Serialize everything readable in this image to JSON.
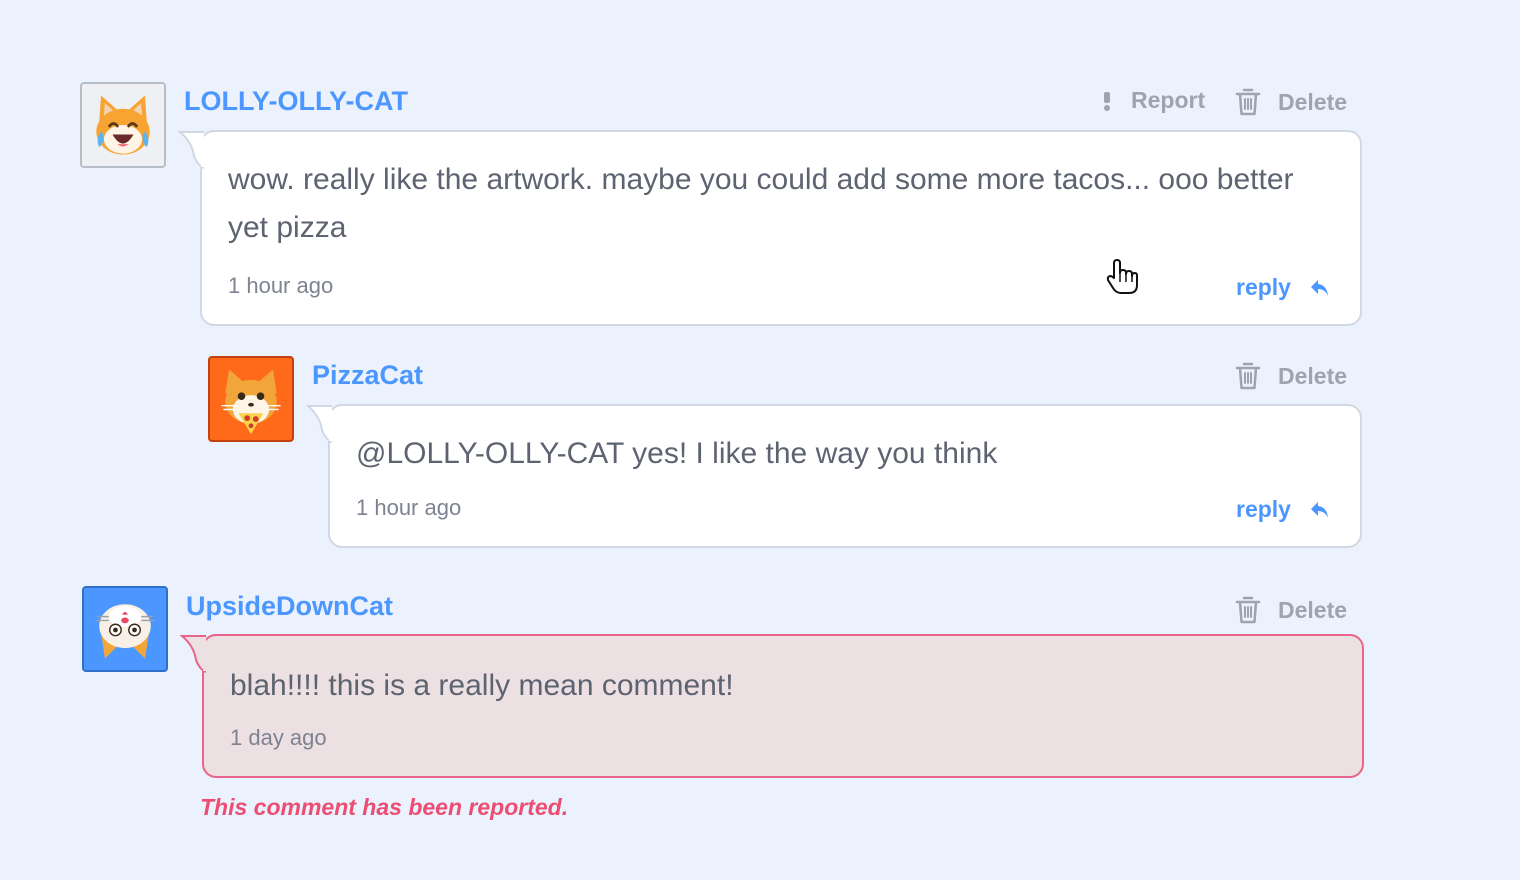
{
  "comments": [
    {
      "username": "LOLLY-OLLY-CAT",
      "avatar_icon": "laughing-cat-icon",
      "body": "wow. really like the artwork. maybe you could add some more tacos... ooo better yet pizza",
      "timestamp": "1 hour ago",
      "report_label": "Report",
      "delete_label": "Delete",
      "reply_label": "reply"
    },
    {
      "username": "PizzaCat",
      "avatar_icon": "pizza-cat-icon",
      "body": "@LOLLY-OLLY-CAT yes! I like the way you think",
      "timestamp": "1 hour ago",
      "delete_label": "Delete",
      "reply_label": "reply"
    },
    {
      "username": "UpsideDownCat",
      "avatar_icon": "upside-down-cat-icon",
      "body": "blah!!!! this is a really mean comment!",
      "timestamp": "1 day ago",
      "delete_label": "Delete",
      "reported_notice": "This comment has been reported."
    }
  ],
  "colors": {
    "background": "#ebf2fd",
    "link": "#4c97ff",
    "muted": "#9da3b0",
    "reported_border": "#e9648a",
    "reported_text": "#ec4d72"
  }
}
